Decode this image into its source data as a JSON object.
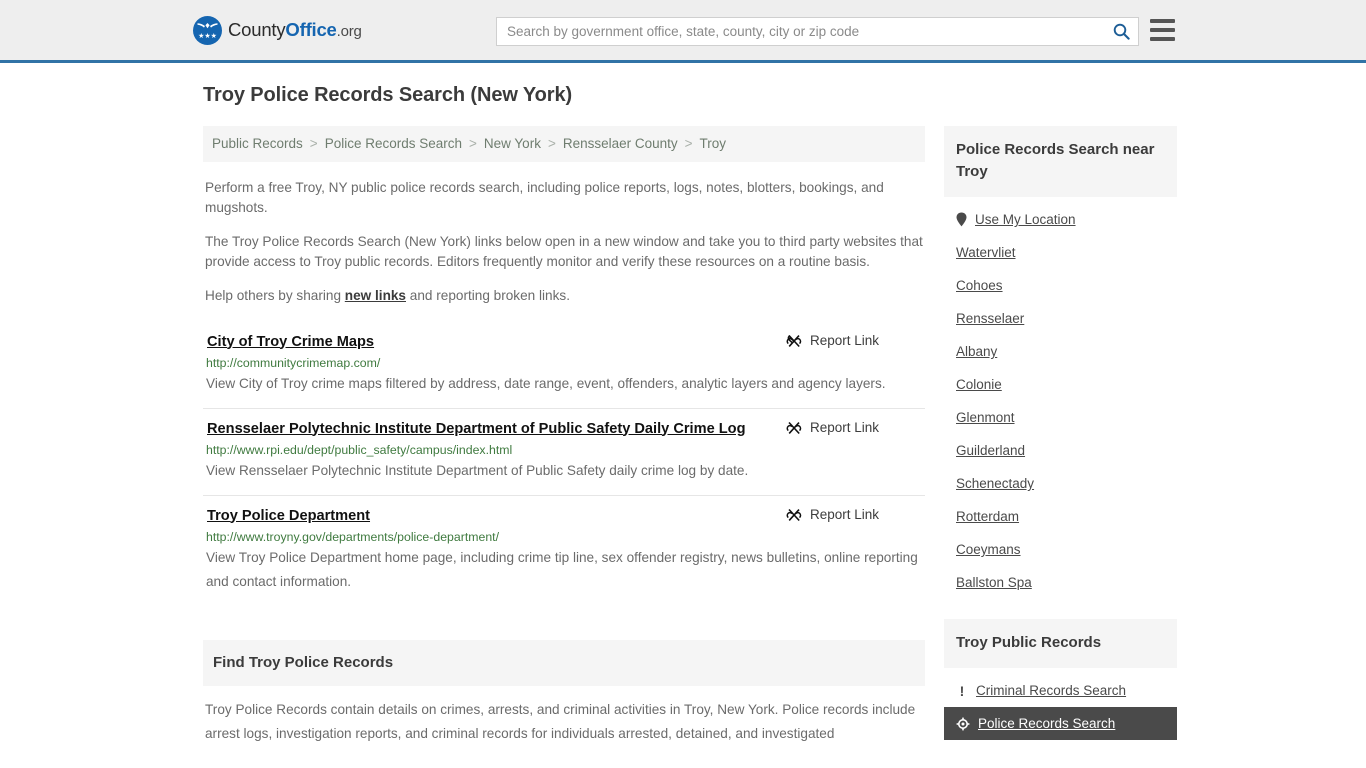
{
  "header": {
    "brand": {
      "part1": "County",
      "part2": "Office",
      "tld": ".org",
      "logo_icon": "eagle-shield-logo"
    },
    "search": {
      "placeholder": "Search by government office, state, county, city or zip code",
      "value": "",
      "search_icon": "search-icon"
    },
    "menu_icon": "hamburger-menu-icon",
    "accent_color": "#3173a6"
  },
  "page": {
    "title": "Troy Police Records Search (New York)",
    "breadcrumb": [
      "Public Records",
      "Police Records Search",
      "New York",
      "Rensselaer County",
      "Troy"
    ],
    "breadcrumb_separator": ">",
    "intro_1": "Perform a free Troy, NY public police records search, including police reports, logs, notes, blotters, bookings, and mugshots.",
    "intro_2": "The Troy Police Records Search (New York) links below open in a new window and take you to third party websites that provide access to Troy public records. Editors frequently monitor and verify these resources on a routine basis.",
    "intro_3_before": "Help others by sharing ",
    "intro_3_link": "new links",
    "intro_3_after": " and reporting broken links."
  },
  "links": [
    {
      "title": "City of Troy Crime Maps",
      "url": "http://communitycrimemap.com/",
      "description": "View City of Troy crime maps filtered by address, date range, event, offenders, analytic layers and agency layers.",
      "report_label": "Report Link",
      "report_icon": "broken-link-icon"
    },
    {
      "title": "Rensselaer Polytechnic Institute Department of Public Safety Daily Crime Log",
      "url": "http://www.rpi.edu/dept/public_safety/campus/index.html",
      "description": "View Rensselaer Polytechnic Institute Department of Public Safety daily crime log by date.",
      "report_label": "Report Link",
      "report_icon": "broken-link-icon"
    },
    {
      "title": "Troy Police Department",
      "url": "http://www.troyny.gov/departments/police-department/",
      "description": "View Troy Police Department home page, including crime tip line, sex offender registry, news bulletins, online reporting and contact information.",
      "report_label": "Report Link",
      "report_icon": "broken-link-icon"
    }
  ],
  "find_section": {
    "heading": "Find Troy Police Records",
    "body": "Troy Police Records contain details on crimes, arrests, and criminal activities in Troy, New York. Police records include arrest logs, investigation reports, and criminal records for individuals arrested, detained, and investigated"
  },
  "sidebar": {
    "nearby_heading": "Police Records Search near Troy",
    "use_my_location": {
      "label": "Use My Location",
      "icon": "map-pin-icon"
    },
    "nearby": [
      "Watervliet",
      "Cohoes",
      "Rensselaer",
      "Albany",
      "Colonie",
      "Glenmont",
      "Guilderland",
      "Schenectady",
      "Rotterdam",
      "Coeymans",
      "Ballston Spa"
    ],
    "records_heading": "Troy Public Records",
    "records": [
      {
        "label": "Criminal Records Search",
        "icon": "exclamation-icon",
        "active": false
      },
      {
        "label": "Police Records Search",
        "icon": "police-badge-icon",
        "active": true
      }
    ]
  }
}
